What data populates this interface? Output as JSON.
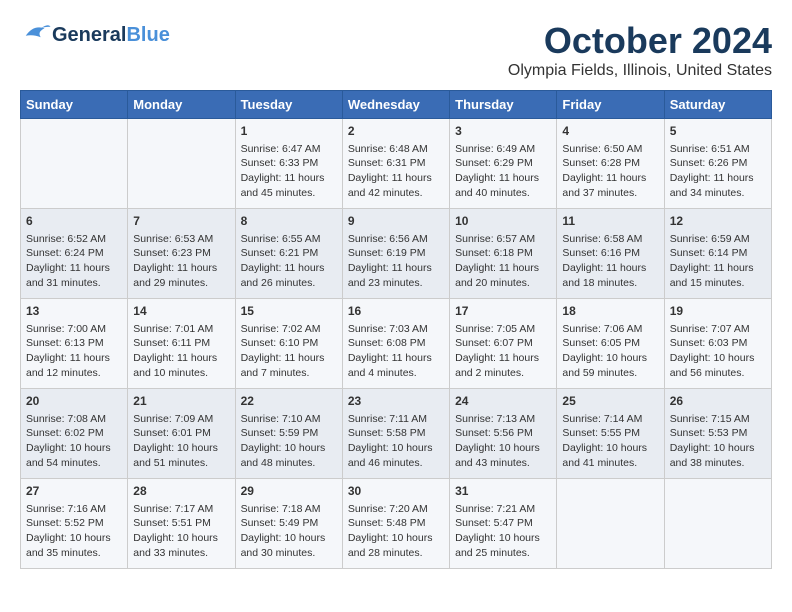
{
  "logo": {
    "line1": "General",
    "line2": "Blue"
  },
  "title": "October 2024",
  "location": "Olympia Fields, Illinois, United States",
  "days_of_week": [
    "Sunday",
    "Monday",
    "Tuesday",
    "Wednesday",
    "Thursday",
    "Friday",
    "Saturday"
  ],
  "weeks": [
    [
      {
        "day": "",
        "info": ""
      },
      {
        "day": "",
        "info": ""
      },
      {
        "day": "1",
        "info": "Sunrise: 6:47 AM\nSunset: 6:33 PM\nDaylight: 11 hours and 45 minutes."
      },
      {
        "day": "2",
        "info": "Sunrise: 6:48 AM\nSunset: 6:31 PM\nDaylight: 11 hours and 42 minutes."
      },
      {
        "day": "3",
        "info": "Sunrise: 6:49 AM\nSunset: 6:29 PM\nDaylight: 11 hours and 40 minutes."
      },
      {
        "day": "4",
        "info": "Sunrise: 6:50 AM\nSunset: 6:28 PM\nDaylight: 11 hours and 37 minutes."
      },
      {
        "day": "5",
        "info": "Sunrise: 6:51 AM\nSunset: 6:26 PM\nDaylight: 11 hours and 34 minutes."
      }
    ],
    [
      {
        "day": "6",
        "info": "Sunrise: 6:52 AM\nSunset: 6:24 PM\nDaylight: 11 hours and 31 minutes."
      },
      {
        "day": "7",
        "info": "Sunrise: 6:53 AM\nSunset: 6:23 PM\nDaylight: 11 hours and 29 minutes."
      },
      {
        "day": "8",
        "info": "Sunrise: 6:55 AM\nSunset: 6:21 PM\nDaylight: 11 hours and 26 minutes."
      },
      {
        "day": "9",
        "info": "Sunrise: 6:56 AM\nSunset: 6:19 PM\nDaylight: 11 hours and 23 minutes."
      },
      {
        "day": "10",
        "info": "Sunrise: 6:57 AM\nSunset: 6:18 PM\nDaylight: 11 hours and 20 minutes."
      },
      {
        "day": "11",
        "info": "Sunrise: 6:58 AM\nSunset: 6:16 PM\nDaylight: 11 hours and 18 minutes."
      },
      {
        "day": "12",
        "info": "Sunrise: 6:59 AM\nSunset: 6:14 PM\nDaylight: 11 hours and 15 minutes."
      }
    ],
    [
      {
        "day": "13",
        "info": "Sunrise: 7:00 AM\nSunset: 6:13 PM\nDaylight: 11 hours and 12 minutes."
      },
      {
        "day": "14",
        "info": "Sunrise: 7:01 AM\nSunset: 6:11 PM\nDaylight: 11 hours and 10 minutes."
      },
      {
        "day": "15",
        "info": "Sunrise: 7:02 AM\nSunset: 6:10 PM\nDaylight: 11 hours and 7 minutes."
      },
      {
        "day": "16",
        "info": "Sunrise: 7:03 AM\nSunset: 6:08 PM\nDaylight: 11 hours and 4 minutes."
      },
      {
        "day": "17",
        "info": "Sunrise: 7:05 AM\nSunset: 6:07 PM\nDaylight: 11 hours and 2 minutes."
      },
      {
        "day": "18",
        "info": "Sunrise: 7:06 AM\nSunset: 6:05 PM\nDaylight: 10 hours and 59 minutes."
      },
      {
        "day": "19",
        "info": "Sunrise: 7:07 AM\nSunset: 6:03 PM\nDaylight: 10 hours and 56 minutes."
      }
    ],
    [
      {
        "day": "20",
        "info": "Sunrise: 7:08 AM\nSunset: 6:02 PM\nDaylight: 10 hours and 54 minutes."
      },
      {
        "day": "21",
        "info": "Sunrise: 7:09 AM\nSunset: 6:01 PM\nDaylight: 10 hours and 51 minutes."
      },
      {
        "day": "22",
        "info": "Sunrise: 7:10 AM\nSunset: 5:59 PM\nDaylight: 10 hours and 48 minutes."
      },
      {
        "day": "23",
        "info": "Sunrise: 7:11 AM\nSunset: 5:58 PM\nDaylight: 10 hours and 46 minutes."
      },
      {
        "day": "24",
        "info": "Sunrise: 7:13 AM\nSunset: 5:56 PM\nDaylight: 10 hours and 43 minutes."
      },
      {
        "day": "25",
        "info": "Sunrise: 7:14 AM\nSunset: 5:55 PM\nDaylight: 10 hours and 41 minutes."
      },
      {
        "day": "26",
        "info": "Sunrise: 7:15 AM\nSunset: 5:53 PM\nDaylight: 10 hours and 38 minutes."
      }
    ],
    [
      {
        "day": "27",
        "info": "Sunrise: 7:16 AM\nSunset: 5:52 PM\nDaylight: 10 hours and 35 minutes."
      },
      {
        "day": "28",
        "info": "Sunrise: 7:17 AM\nSunset: 5:51 PM\nDaylight: 10 hours and 33 minutes."
      },
      {
        "day": "29",
        "info": "Sunrise: 7:18 AM\nSunset: 5:49 PM\nDaylight: 10 hours and 30 minutes."
      },
      {
        "day": "30",
        "info": "Sunrise: 7:20 AM\nSunset: 5:48 PM\nDaylight: 10 hours and 28 minutes."
      },
      {
        "day": "31",
        "info": "Sunrise: 7:21 AM\nSunset: 5:47 PM\nDaylight: 10 hours and 25 minutes."
      },
      {
        "day": "",
        "info": ""
      },
      {
        "day": "",
        "info": ""
      }
    ]
  ]
}
